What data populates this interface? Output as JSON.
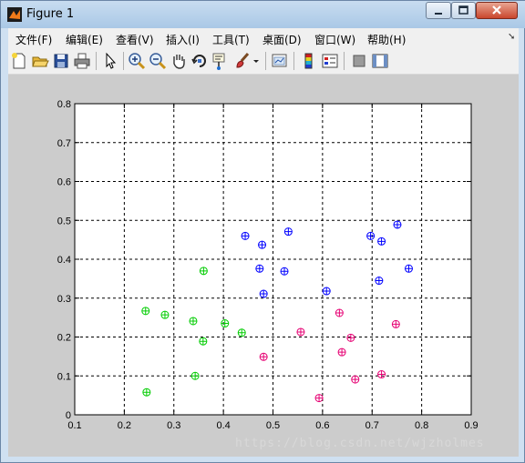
{
  "window": {
    "title": "Figure 1"
  },
  "menu": [
    {
      "label": "文件(F)"
    },
    {
      "label": "编辑(E)"
    },
    {
      "label": "查看(V)"
    },
    {
      "label": "插入(I)"
    },
    {
      "label": "工具(T)"
    },
    {
      "label": "桌面(D)"
    },
    {
      "label": "窗口(W)"
    },
    {
      "label": "帮助(H)"
    }
  ],
  "toolbar": {
    "icons": [
      "new-figure-icon",
      "open-folder-icon",
      "save-icon",
      "print-icon",
      "select-arrow-icon",
      "zoom-in-icon",
      "zoom-out-icon",
      "pan-hand-icon",
      "rotate-3d-icon",
      "data-cursor-icon",
      "brush-icon",
      "brush-dropdown-icon",
      "link-plot-icon",
      "colorbar-icon",
      "legend-icon",
      "hide-plot-tools-icon",
      "show-plot-tools-icon"
    ]
  },
  "watermark": "https://blog.csdn.net/wjzholmes",
  "chart_data": {
    "type": "scatter",
    "grid": true,
    "grid_style": "dashed",
    "xlim": [
      0.1,
      0.9
    ],
    "ylim": [
      0,
      0.8
    ],
    "xticks": [
      "0.1",
      "0.2",
      "0.3",
      "0.4",
      "0.5",
      "0.6",
      "0.7",
      "0.8",
      "0.9"
    ],
    "yticks": [
      "0",
      "0.1",
      "0.2",
      "0.3",
      "0.4",
      "0.5",
      "0.6",
      "0.7",
      "0.8"
    ],
    "series": [
      {
        "color": "#0000ff",
        "marker": "circle-plus",
        "x": [
          0.444,
          0.478,
          0.531,
          0.473,
          0.523,
          0.481,
          0.608,
          0.697,
          0.719,
          0.751,
          0.774,
          0.714
        ],
        "y": [
          0.46,
          0.437,
          0.471,
          0.376,
          0.369,
          0.311,
          0.318,
          0.46,
          0.446,
          0.489,
          0.376,
          0.345
        ]
      },
      {
        "color": "#00cc00",
        "marker": "circle-plus",
        "x": [
          0.243,
          0.282,
          0.36,
          0.339,
          0.403,
          0.437,
          0.359,
          0.343,
          0.245
        ],
        "y": [
          0.267,
          0.257,
          0.37,
          0.241,
          0.235,
          0.211,
          0.189,
          0.1,
          0.058
        ]
      },
      {
        "color": "#e60073",
        "marker": "circle-plus",
        "x": [
          0.556,
          0.481,
          0.634,
          0.657,
          0.639,
          0.748,
          0.666,
          0.719,
          0.593
        ],
        "y": [
          0.213,
          0.149,
          0.262,
          0.198,
          0.161,
          0.233,
          0.091,
          0.104,
          0.043
        ]
      }
    ]
  }
}
